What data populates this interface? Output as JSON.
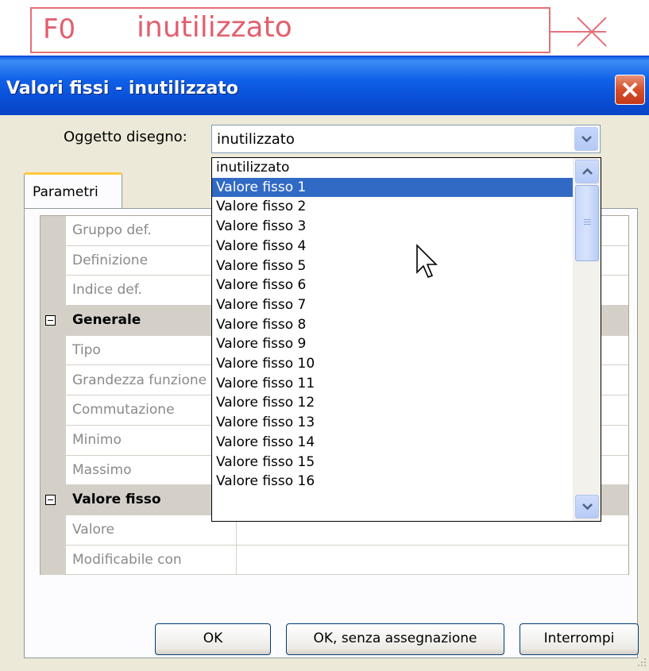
{
  "function_block": {
    "id": "F0",
    "name": "inutilizzato"
  },
  "dialog": {
    "title": "Valori fissi - inutilizzato",
    "object_label": "Oggetto disegno:",
    "object_value": "inutilizzato",
    "tab": "Parametri",
    "properties": [
      {
        "name": "Gruppo def.",
        "category": false
      },
      {
        "name": "Definizione",
        "category": false
      },
      {
        "name": "Indice def.",
        "category": false
      },
      {
        "name": "Generale",
        "category": true
      },
      {
        "name": "Tipo",
        "category": false
      },
      {
        "name": "Grandezza funzione",
        "category": false
      },
      {
        "name": "Commutazione",
        "category": false
      },
      {
        "name": "Minimo",
        "category": false
      },
      {
        "name": "Massimo",
        "category": false
      },
      {
        "name": "Valore fisso",
        "category": true
      },
      {
        "name": "Valore",
        "category": false
      },
      {
        "name": "Modificabile con",
        "category": false
      }
    ],
    "dropdown_items": [
      "inutilizzato",
      "Valore fisso 1",
      "Valore fisso 2",
      "Valore fisso 3",
      "Valore fisso 4",
      "Valore fisso 5",
      "Valore fisso 6",
      "Valore fisso 7",
      "Valore fisso 8",
      "Valore fisso 9",
      "Valore fisso 10",
      "Valore fisso 11",
      "Valore fisso 12",
      "Valore fisso 13",
      "Valore fisso 14",
      "Valore fisso 15",
      "Valore fisso 16"
    ],
    "highlighted_item": "Valore fisso 1",
    "buttons": {
      "ok": "OK",
      "ok_no_assign": "OK, senza assegnazione",
      "cancel": "Interrompi"
    }
  }
}
